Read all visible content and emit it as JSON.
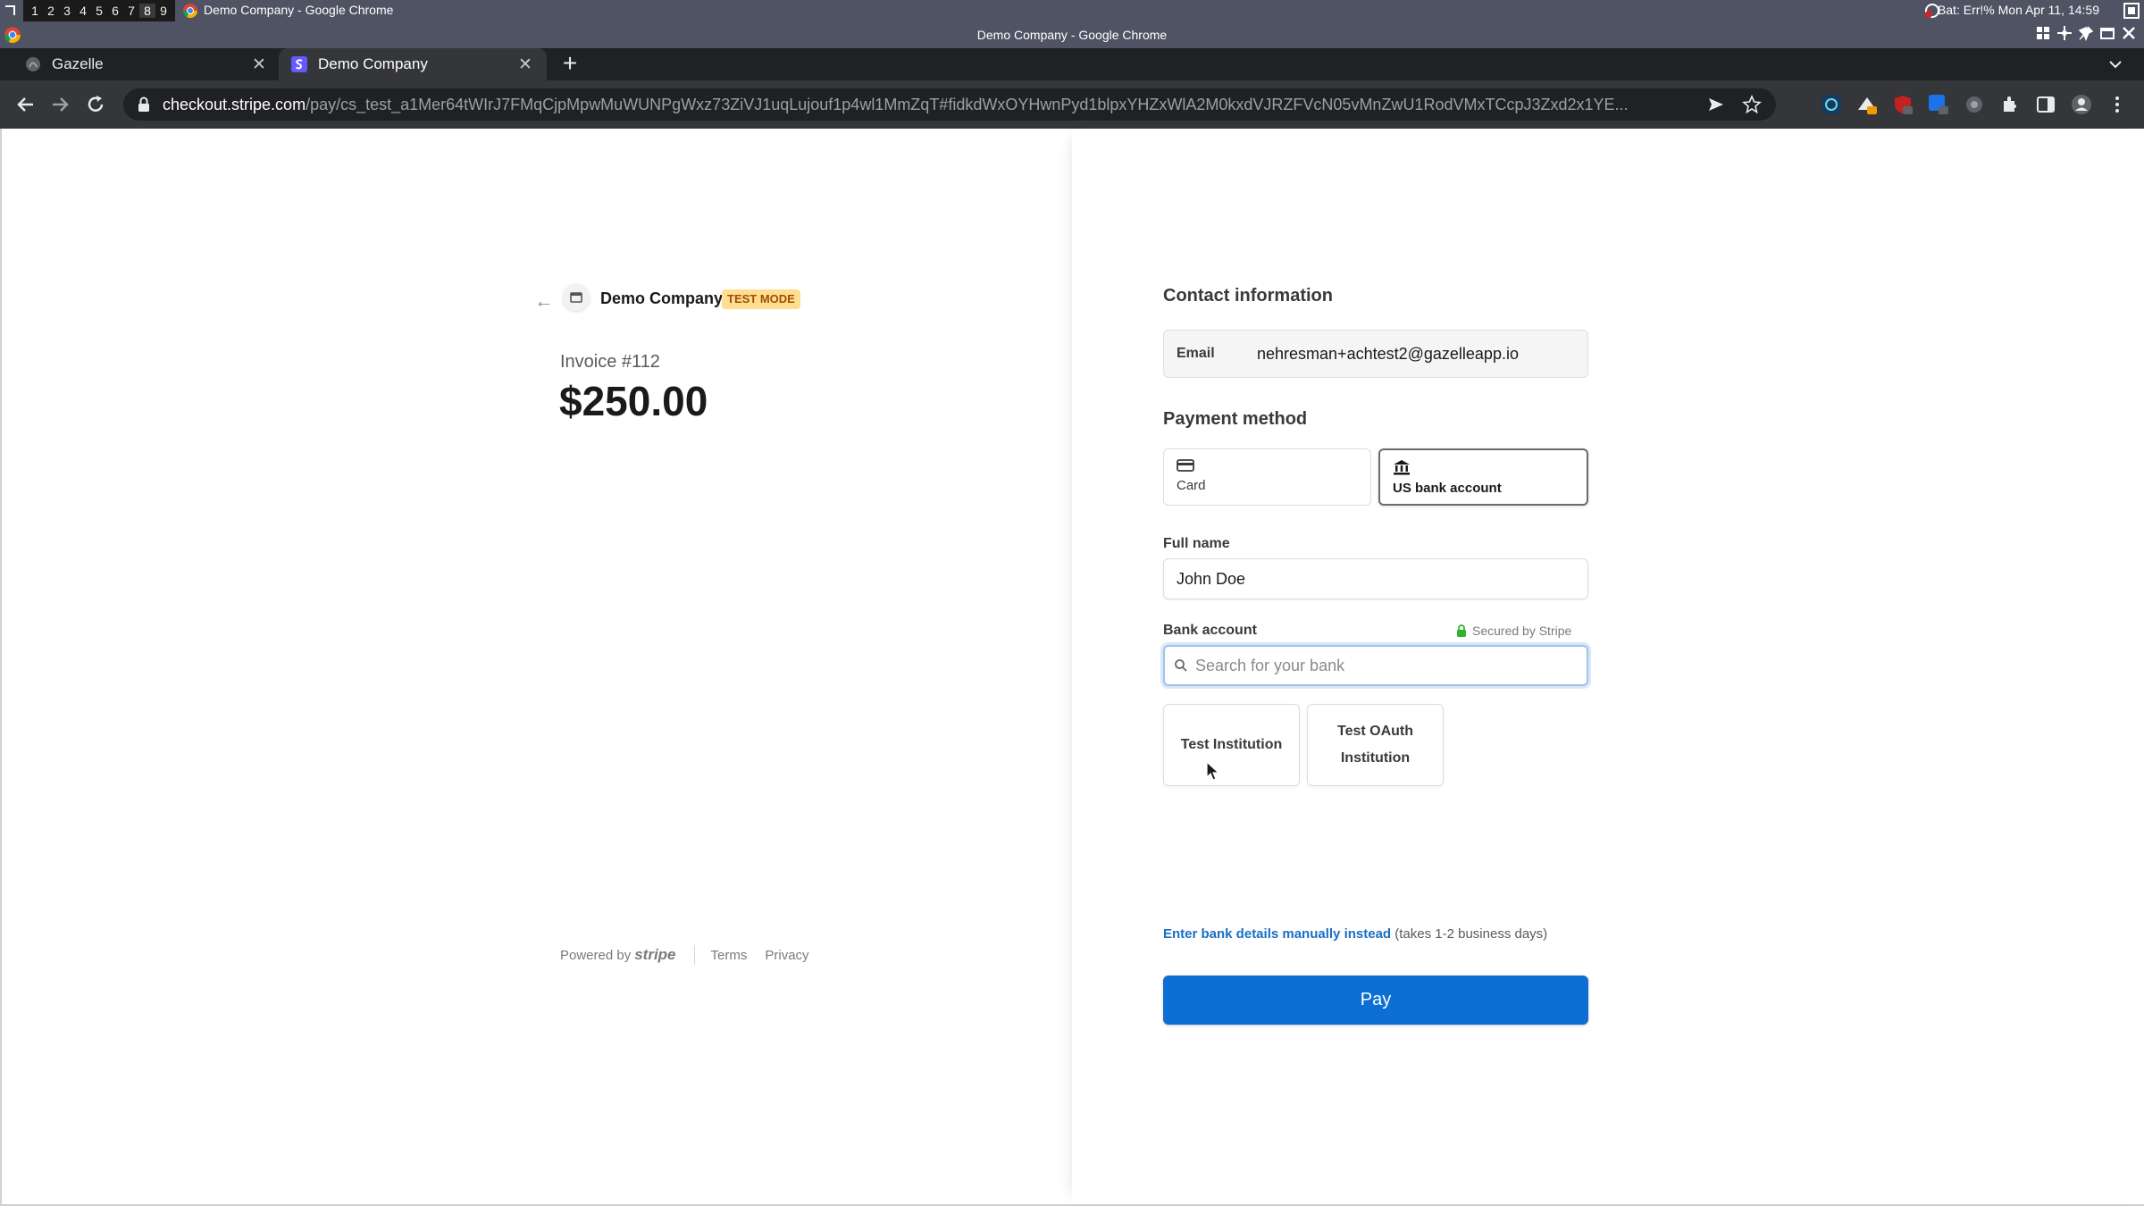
{
  "os": {
    "workspaces": [
      "1",
      "2",
      "3",
      "4",
      "5",
      "6",
      "7",
      "8",
      "9"
    ],
    "active_workspace": "8",
    "window_title": "Demo Company - Google Chrome",
    "status": "Bat: Err!% Mon Apr 11, 14:59"
  },
  "browser": {
    "title": "Demo Company - Google Chrome",
    "tabs": [
      {
        "label": "Gazelle",
        "active": false
      },
      {
        "label": "Demo Company",
        "active": true
      }
    ],
    "url_host": "checkout.stripe.com",
    "url_path": "/pay/cs_test_a1Mer64tWIrJ7FMqCjpMpwMuWUNPgWxz73ZiVJ1uqLujouf1p4wl1MmZqT#fidkdWxOYHwnPyd1blpxYHZxWlA2M0kxdVJRZFVcN05vMnZwU1RodVMxTCcpJ3Zxd2x1YE..."
  },
  "summary": {
    "merchant": "Demo Company",
    "badge": "TEST MODE",
    "invoice": "Invoice #112",
    "amount": "$250.00",
    "powered_by": "Powered by",
    "brand": "stripe",
    "terms": "Terms",
    "privacy": "Privacy"
  },
  "form": {
    "contact_title": "Contact information",
    "email_label": "Email",
    "email_value": "nehresman+achtest2@gazelleapp.io",
    "payment_title": "Payment method",
    "methods": [
      {
        "label": "Card",
        "icon": "card-icon",
        "selected": false
      },
      {
        "label": "US bank account",
        "icon": "bank-icon",
        "selected": true
      }
    ],
    "full_name_label": "Full name",
    "full_name_value": "John Doe",
    "bank_label": "Bank account",
    "secured": "Secured by Stripe",
    "search_placeholder": "Search for your bank",
    "institutions": [
      "Test Institution",
      "Test OAuth Institution"
    ],
    "manual_link": "Enter bank details manually instead",
    "manual_note": " (takes 1-2 business days)",
    "pay_label": "Pay"
  },
  "colors": {
    "pay_button": "#0c6fd1",
    "test_badge_bg": "#ffde92",
    "link": "#1a6fc5"
  }
}
